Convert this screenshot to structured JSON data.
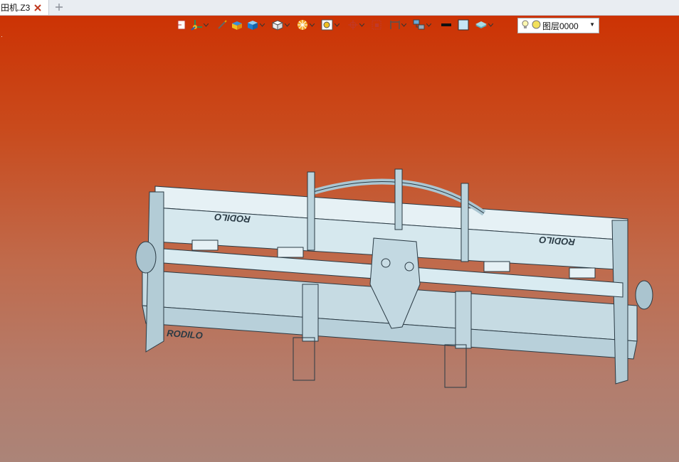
{
  "tab": {
    "title": "田机.Z3"
  },
  "toolbar": {
    "buttons": [
      {
        "name": "view-orient-icon"
      },
      {
        "name": "axis-triad-icon"
      },
      {
        "name": "pen-icon"
      },
      {
        "name": "shaded-box-icon"
      },
      {
        "name": "blue-cube-icon"
      },
      {
        "name": "white-cube-icon"
      },
      {
        "name": "color-wheel-icon"
      },
      {
        "name": "zoom-fit-icon"
      },
      {
        "name": "crosshair-icon"
      },
      {
        "name": "frame-select-icon"
      },
      {
        "name": "section-icon"
      },
      {
        "name": "assembly-icon"
      },
      {
        "name": "line-color-icon"
      },
      {
        "name": "fill-color-icon"
      },
      {
        "name": "layer-stack-icon"
      }
    ]
  },
  "layer": {
    "label": "图层0000"
  },
  "model": {
    "brand_left": "RODILO",
    "brand_top_left": "RODILO",
    "brand_top_right": "RODILO"
  },
  "colors": {
    "accent": "#cc3304",
    "model_fill": "#c9dde5",
    "model_edge": "#2a3a44"
  }
}
